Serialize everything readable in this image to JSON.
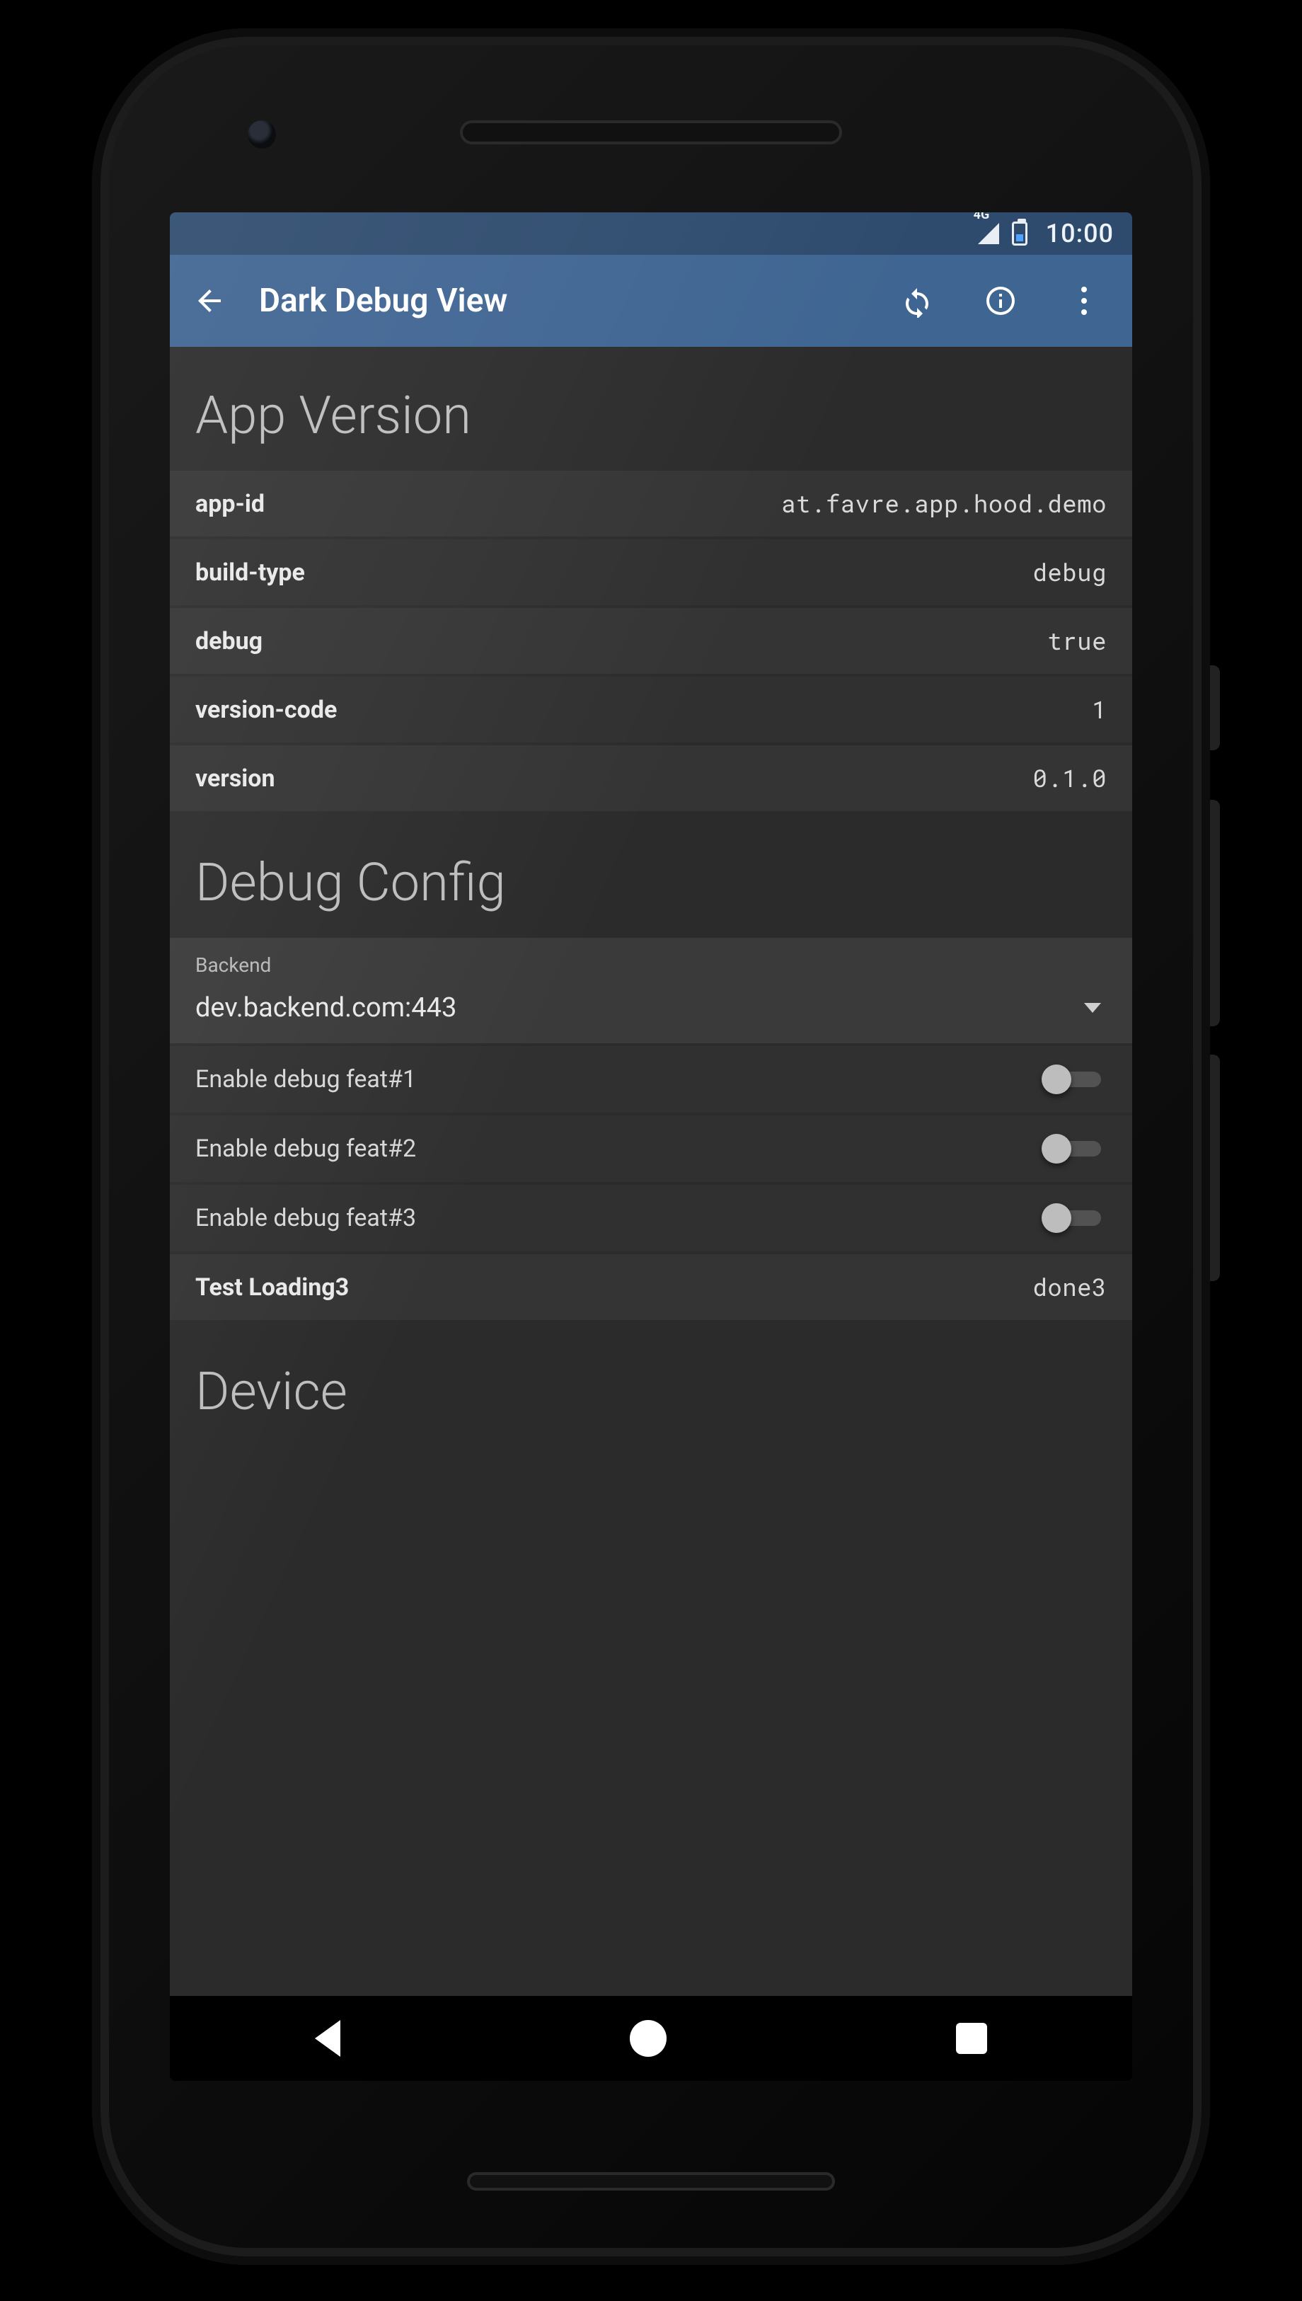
{
  "statusbar": {
    "network_badge": "4G",
    "time": "10:00"
  },
  "toolbar": {
    "title": "Dark Debug View",
    "back_icon": "arrow-back",
    "actions": {
      "refresh": "refresh-icon",
      "info": "info-icon",
      "more": "more-vert-icon"
    }
  },
  "sections": {
    "app_version": {
      "title": "App Version",
      "rows": [
        {
          "key": "app-id",
          "value": "at.favre.app.hood.demo"
        },
        {
          "key": "build-type",
          "value": "debug"
        },
        {
          "key": "debug",
          "value": "true"
        },
        {
          "key": "version-code",
          "value": "1"
        },
        {
          "key": "version",
          "value": "0.1.0"
        }
      ]
    },
    "debug_config": {
      "title": "Debug Config",
      "backend": {
        "label": "Backend",
        "value": "dev.backend.com:443"
      },
      "toggles": [
        {
          "label": "Enable debug feat#1",
          "on": false
        },
        {
          "label": "Enable debug feat#2",
          "on": false
        },
        {
          "label": "Enable debug feat#3",
          "on": false
        }
      ],
      "status_row": {
        "key": "Test Loading3",
        "value": "done3"
      }
    },
    "device": {
      "title": "Device"
    }
  },
  "navbar": {
    "back": "nav-back",
    "home": "nav-home",
    "recents": "nav-recents"
  }
}
